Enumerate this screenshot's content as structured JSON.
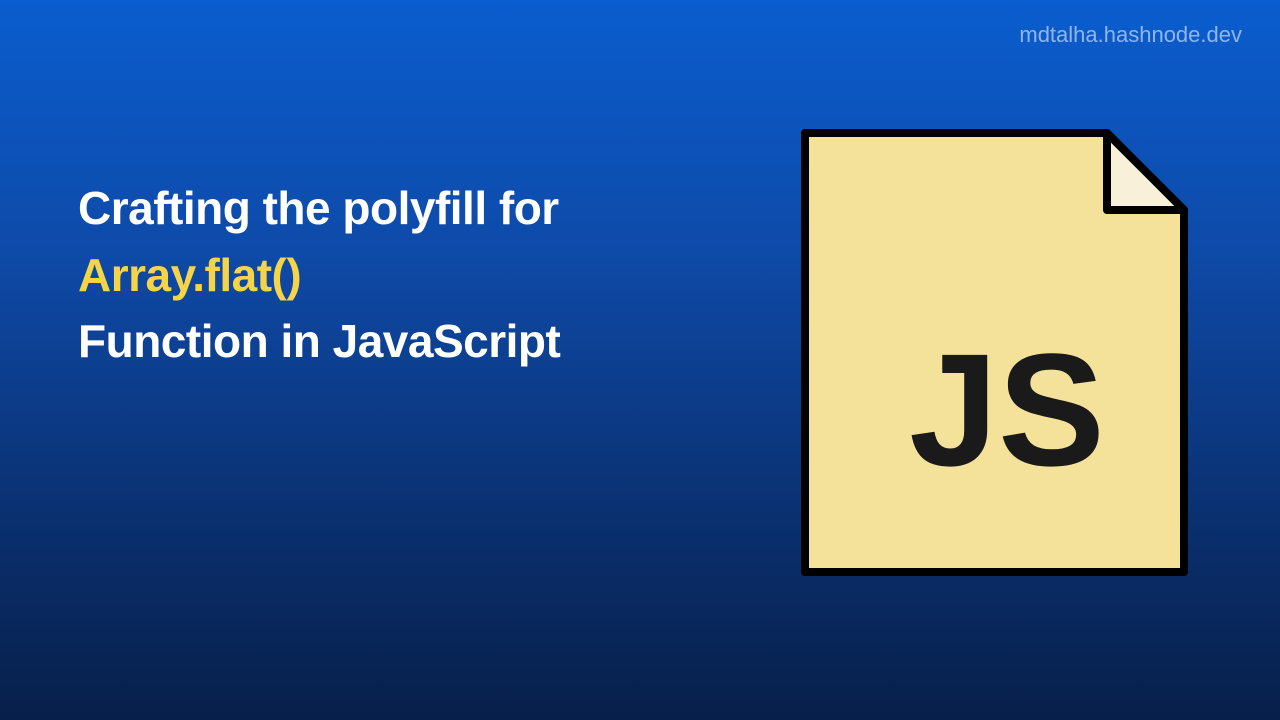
{
  "site_url": "mdtalha.hashnode.dev",
  "headline": {
    "line1": "Crafting the polyfill for",
    "line2": "Array.flat()",
    "line3": "Function in JavaScript"
  },
  "icon": {
    "label": "JS",
    "fill_color": "#f5e29a",
    "fold_color": "#f8f0d8",
    "text_color": "#1a1a1a"
  }
}
